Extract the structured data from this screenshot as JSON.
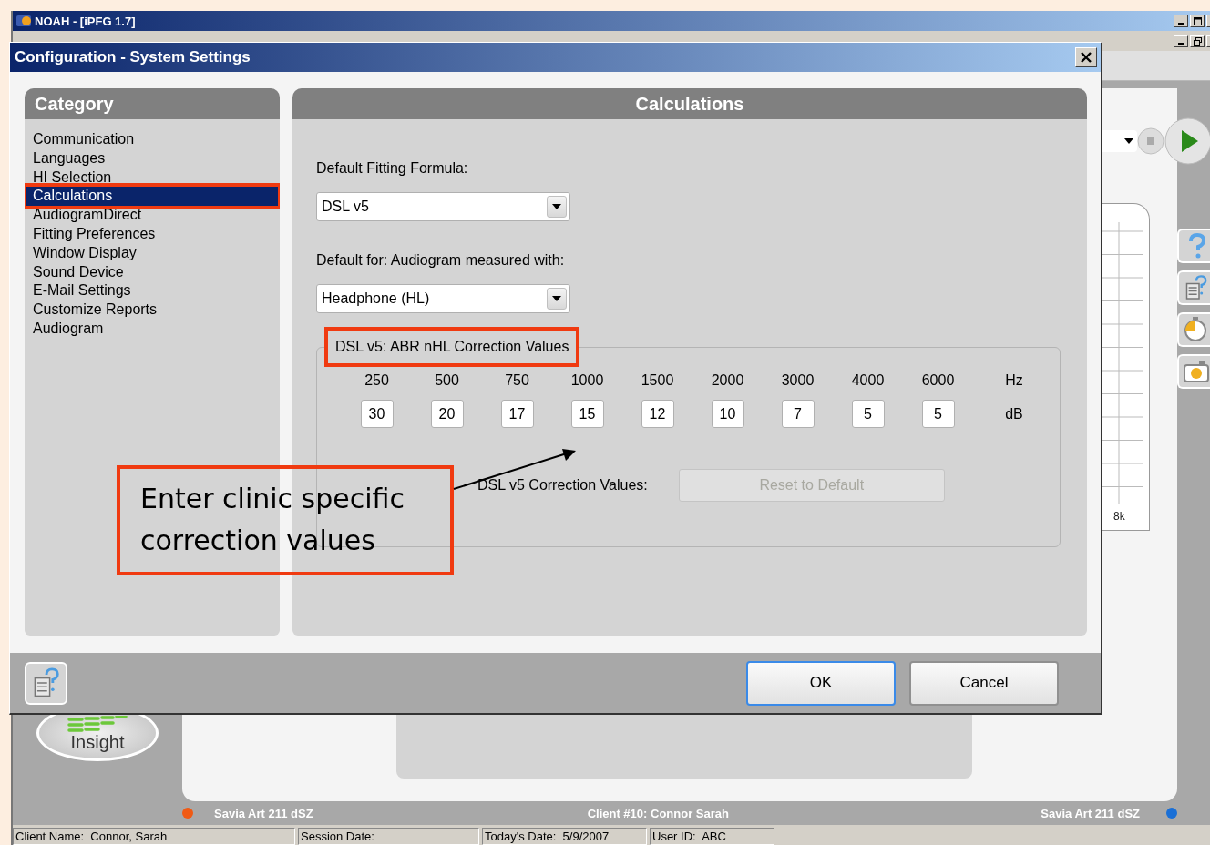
{
  "app_window": {
    "title": "NOAH - [iPFG 1.7]"
  },
  "background": {
    "chart_label": "8k",
    "logo_text": "Insight",
    "client": "Client #10: Connor Sarah",
    "devices": [
      {
        "label": "Savia Art 211 dSZ",
        "color": "#f05a14"
      },
      {
        "label": "Savia Art 211 dSZ",
        "color": "#1a6fd6"
      }
    ]
  },
  "status_bar": [
    "Client Name:  Connor, Sarah",
    "Session Date:",
    "Today's Date:  5/9/2007",
    "User ID:  ABC"
  ],
  "dialog": {
    "title": "Configuration - System Settings",
    "category": {
      "heading": "Category",
      "items": [
        {
          "label": "Communication",
          "selected": false,
          "highlighted": false
        },
        {
          "label": "Languages",
          "selected": false,
          "highlighted": false
        },
        {
          "label": "HI Selection",
          "selected": false,
          "highlighted": false
        },
        {
          "label": "Calculations",
          "selected": true,
          "highlighted": true
        },
        {
          "label": "AudiogramDirect",
          "selected": false,
          "highlighted": false
        },
        {
          "label": "Fitting Preferences",
          "selected": false,
          "highlighted": false
        },
        {
          "label": "Window Display",
          "selected": false,
          "highlighted": false
        },
        {
          "label": "Sound Device",
          "selected": false,
          "highlighted": false
        },
        {
          "label": "E-Mail Settings",
          "selected": false,
          "highlighted": false
        },
        {
          "label": "Customize Reports",
          "selected": false,
          "highlighted": false
        },
        {
          "label": "Audiogram",
          "selected": false,
          "highlighted": false
        }
      ]
    },
    "panel": {
      "heading": "Calculations",
      "formula_label": "Default Fitting Formula:",
      "formula_value": "DSL v5",
      "audiogram_label": "Default for: Audiogram measured with:",
      "audiogram_value": "Headphone (HL)",
      "group_title": "DSL v5: ABR nHL Correction Values",
      "group_title_highlighted": true,
      "frequencies": [
        {
          "hz": "250",
          "db": "30"
        },
        {
          "hz": "500",
          "db": "20"
        },
        {
          "hz": "750",
          "db": "17"
        },
        {
          "hz": "1000",
          "db": "15"
        },
        {
          "hz": "1500",
          "db": "12"
        },
        {
          "hz": "2000",
          "db": "10"
        },
        {
          "hz": "3000",
          "db": "7"
        },
        {
          "hz": "4000",
          "db": "5"
        },
        {
          "hz": "6000",
          "db": "5"
        }
      ],
      "hz_unit": "Hz",
      "db_unit": "dB",
      "reset_label": "DSL v5 Correction Values:",
      "reset_button": {
        "label": "Reset to Default",
        "disabled": true
      }
    },
    "buttons": [
      {
        "label": "OK",
        "default": true
      },
      {
        "label": "Cancel",
        "default": false
      }
    ]
  },
  "callout": {
    "text": "Enter clinic specific correction values"
  }
}
